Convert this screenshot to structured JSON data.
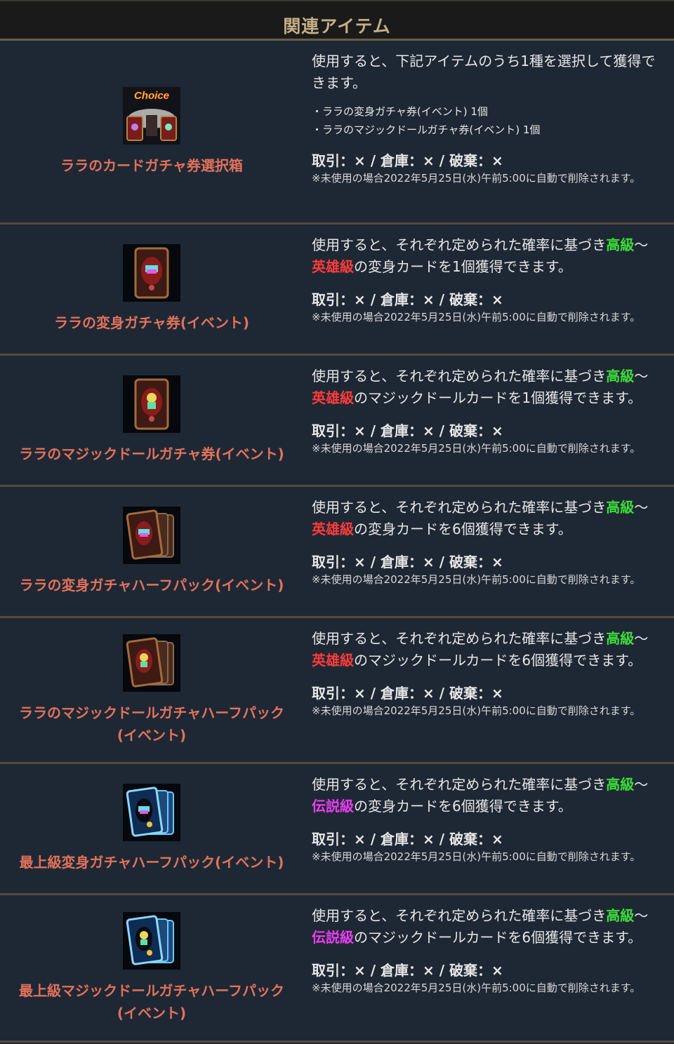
{
  "header": {
    "title": "関連アイテム"
  },
  "rules_text": "取引：× / 倉庫：× / 破棄：×",
  "note_text": "※未使用の場合2022年5月25日(水)午前5:00に自動で削除されます。",
  "items": [
    {
      "name": "ララのカードガチャ券選択箱",
      "icon": "choice-box-icon",
      "desc": "使用すると、下記アイテムのうち1種を選択して獲得できます。",
      "list": [
        "・ララの変身ガチャ券(イベント) 1個",
        "・ララのマジックドールガチャ券(イベント) 1個"
      ]
    },
    {
      "name": "ララの変身ガチャ券(イベント)",
      "icon": "polymorph-card-icon",
      "desc_a": "使用すると、それぞれ定められた確率に基づき",
      "grade_low": "高級",
      "tilde": "～",
      "grade_high": "英雄級",
      "desc_b": "の変身カードを1個獲得できます。"
    },
    {
      "name": "ララのマジックドールガチャ券(イベント)",
      "icon": "magic-doll-card-icon",
      "desc_a": "使用すると、それぞれ定められた確率に基づき",
      "grade_low": "高級",
      "tilde": "～",
      "grade_high": "英雄級",
      "desc_b": "のマジックドールカードを1個獲得できます。"
    },
    {
      "name": "ララの変身ガチャハーフパック(イベント)",
      "icon": "polymorph-pack-icon",
      "desc_a": "使用すると、それぞれ定められた確率に基づき",
      "grade_low": "高級",
      "tilde": "～",
      "grade_high": "英雄級",
      "desc_b": "の変身カードを6個獲得できます。"
    },
    {
      "name_1": "ララのマジックドールガチャハーフパック",
      "name_2": "(イベント)",
      "icon": "magic-doll-pack-icon",
      "desc_a": "使用すると、それぞれ定められた確率に基づき",
      "grade_low": "高級",
      "tilde": "～",
      "grade_high": "英雄級",
      "desc_b": "のマジックドールカードを6個獲得できます。"
    },
    {
      "name": "最上級変身ガチャハーフパック(イベント)",
      "icon": "premium-polymorph-pack-icon",
      "desc_a": "使用すると、それぞれ定められた確率に基づき",
      "grade_low": "高級",
      "tilde": "～",
      "grade_high": "伝説級",
      "desc_b": "の変身カードを6個獲得できます。"
    },
    {
      "name_1": "最上級マジックドールガチャハーフパック",
      "name_2": "(イベント)",
      "icon": "premium-magic-doll-pack-icon",
      "desc_a": "使用すると、それぞれ定められた確率に基づき",
      "grade_low": "高級",
      "tilde": "～",
      "grade_high": "伝説級",
      "desc_b": "のマジックドールカードを6個獲得できます。"
    }
  ],
  "colors": {
    "header_text": "#c4ae86",
    "item_name": "#e2725b",
    "grade_high_class": "#3ddc3a",
    "grade_hero": "#ff3b3b",
    "grade_legend": "#e83ef0",
    "divider": "#57493a"
  }
}
